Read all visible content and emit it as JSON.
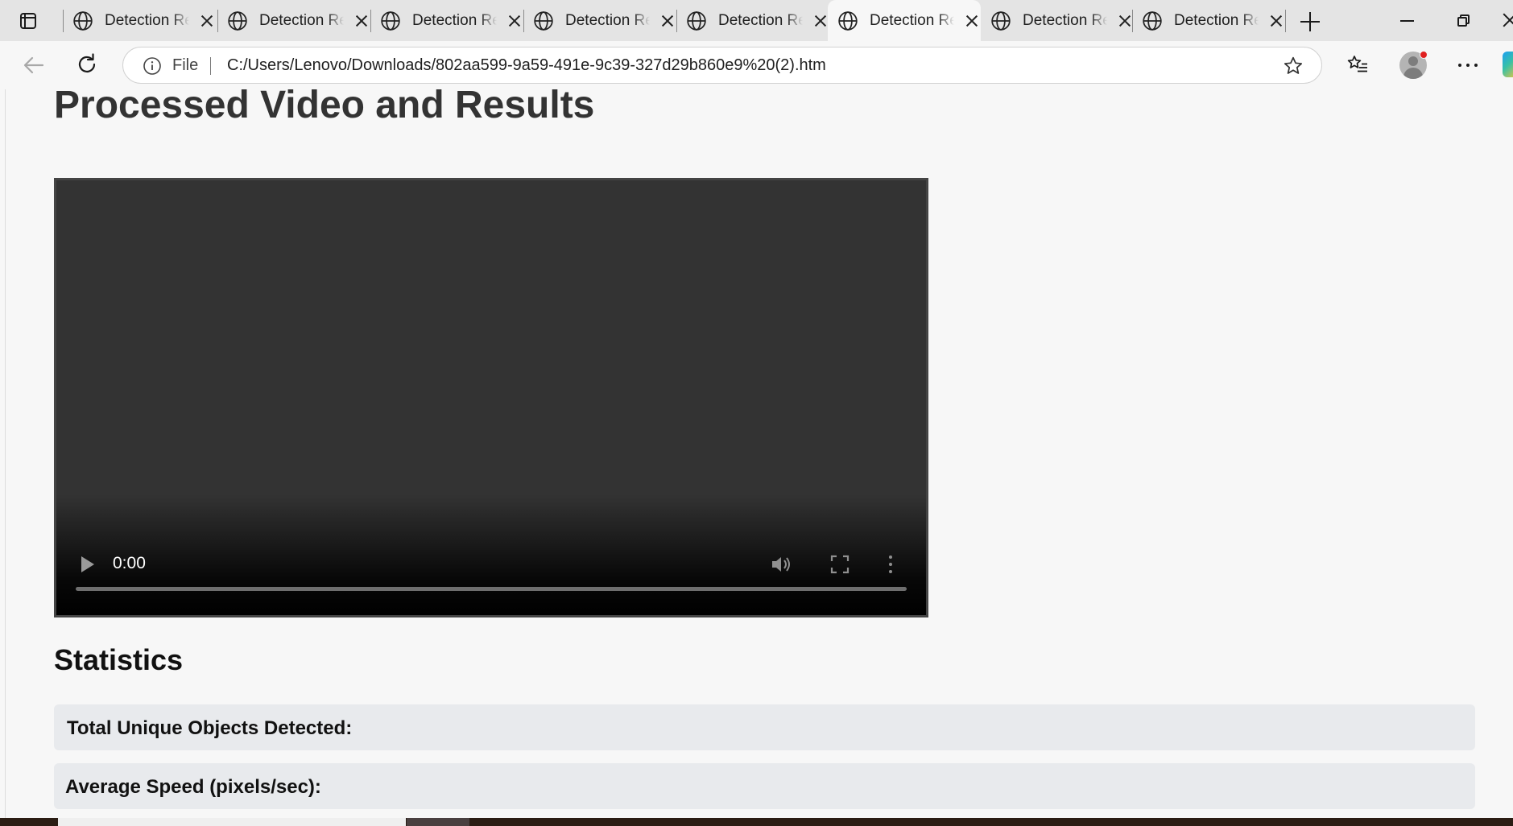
{
  "browser": {
    "tabs": [
      {
        "title": "Detection Results",
        "active": false
      },
      {
        "title": "Detection Results",
        "active": false
      },
      {
        "title": "Detection Results",
        "active": false
      },
      {
        "title": "Detection Results",
        "active": false
      },
      {
        "title": "Detection Results",
        "active": false
      },
      {
        "title": "Detection Results",
        "active": true
      },
      {
        "title": "Detection Results",
        "active": false
      },
      {
        "title": "Detection Results",
        "active": false
      }
    ],
    "address": {
      "scheme_label": "File",
      "url": "C:/Users/Lenovo/Downloads/802aa599-9a59-491e-9c39-327d29b860e9%20(2).htm"
    },
    "icons": {
      "tab_icon": "globe-icon",
      "back": "arrow-left-icon",
      "refresh": "refresh-icon",
      "info": "info-icon",
      "favorite": "star-icon",
      "favorites_list": "favorites-list-icon",
      "profile": "avatar",
      "more": "ellipsis-icon",
      "copilot": "copilot-icon"
    },
    "colors": {
      "tabstrip": "#e4e4e4",
      "page_bg": "#f7f7f7",
      "profile_notice": "#e02020"
    }
  },
  "page": {
    "title": "Processed Video and Results",
    "video": {
      "time": "0:00",
      "progress": 0,
      "icons": [
        "play-icon",
        "volume-icon",
        "fullscreen-icon",
        "more-vert-icon"
      ]
    },
    "statistics": {
      "heading": "Statistics",
      "items": [
        {
          "label": "Total Unique Objects Detected:",
          "value": ""
        },
        {
          "label": "Average Speed (pixels/sec):",
          "value": ""
        }
      ]
    }
  }
}
